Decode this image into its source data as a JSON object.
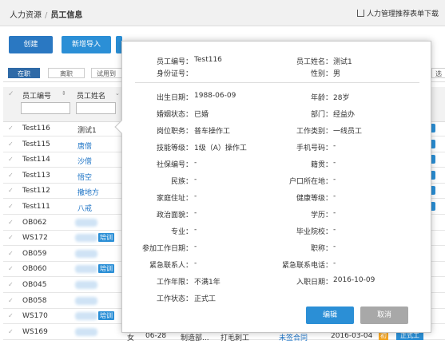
{
  "breadcrumb": {
    "root": "人力资源",
    "sep": "/",
    "current": "员工信息"
  },
  "download": {
    "label": "人力管理推荐表单下载"
  },
  "toolbar": {
    "create": "创建",
    "batch_import": "新增导入"
  },
  "filters": {
    "active": "在职",
    "inactive": "离职",
    "probation": "试用到期"
  },
  "extra_filter": "选",
  "table": {
    "headers": {
      "employee_id": "员工编号",
      "employee_name": "员工姓名"
    },
    "rows": [
      {
        "id": "Test116",
        "name": "测试1",
        "name_style": "plain",
        "tag": ""
      },
      {
        "id": "Test115",
        "name": "唐僧",
        "name_style": "link",
        "tag": ""
      },
      {
        "id": "Test114",
        "name": "沙僧",
        "name_style": "link",
        "tag": ""
      },
      {
        "id": "Test113",
        "name": "悟空",
        "name_style": "link",
        "tag": ""
      },
      {
        "id": "Test112",
        "name": "撒地方",
        "name_style": "link",
        "tag": ""
      },
      {
        "id": "Test111",
        "name": "八戒",
        "name_style": "link",
        "tag": ""
      },
      {
        "id": "OB062",
        "name": "",
        "name_style": "blur",
        "tag": ""
      },
      {
        "id": "WS172",
        "name": "",
        "name_style": "blur",
        "tag": "培训"
      },
      {
        "id": "OB059",
        "name": "",
        "name_style": "blur",
        "tag": ""
      },
      {
        "id": "OB060",
        "name": "",
        "name_style": "blur",
        "tag": "培训"
      },
      {
        "id": "OB045",
        "name": "",
        "name_style": "blur",
        "tag": ""
      },
      {
        "id": "OB058",
        "name": "",
        "name_style": "blur",
        "tag": ""
      },
      {
        "id": "WS170",
        "name": "",
        "name_style": "blur",
        "tag": "培训"
      },
      {
        "id": "WS169",
        "name": "",
        "name_style": "blur",
        "tag": ""
      }
    ],
    "bottom_row": {
      "gender": "女",
      "date": "06-28",
      "dept": "制造部...",
      "role": "打毛刺工",
      "link": "未签合同",
      "start": "2016-03-04",
      "badge": "初",
      "action": "正式工"
    }
  },
  "detail": {
    "fields": [
      {
        "label": "员工编号：",
        "value": "Test116"
      },
      {
        "label": "员工姓名：",
        "value": "测试1"
      },
      {
        "label": "身份证号：",
        "value": ""
      },
      {
        "label": "性别：",
        "value": "男"
      },
      {
        "label": "出生日期：",
        "value": "1988-06-09"
      },
      {
        "label": "年龄：",
        "value": "28岁"
      },
      {
        "label": "婚姻状态：",
        "value": "已婚"
      },
      {
        "label": "部门：",
        "value": "经益办"
      },
      {
        "label": "岗位职务：",
        "value": "普车操作工"
      },
      {
        "label": "工作类别：",
        "value": "一线员工"
      },
      {
        "label": "技能等级：",
        "value": "1级（A）操作工"
      },
      {
        "label": "手机号码：",
        "value": "-"
      },
      {
        "label": "社保编号：",
        "value": "-"
      },
      {
        "label": "籍贯：",
        "value": "-"
      },
      {
        "label": "民族：",
        "value": "-"
      },
      {
        "label": "户口所在地：",
        "value": "-"
      },
      {
        "label": "家庭住址：",
        "value": "-"
      },
      {
        "label": "健康等级：",
        "value": "-"
      },
      {
        "label": "政治面貌：",
        "value": "-"
      },
      {
        "label": "学历：",
        "value": "-"
      },
      {
        "label": "专业：",
        "value": "-"
      },
      {
        "label": "毕业院校：",
        "value": "-"
      },
      {
        "label": "参加工作日期：",
        "value": "-"
      },
      {
        "label": "职称：",
        "value": "-"
      },
      {
        "label": "紧急联系人：",
        "value": "-"
      },
      {
        "label": "紧急联系电话：",
        "value": "-"
      },
      {
        "label": "工作年限：",
        "value": "不满1年"
      },
      {
        "label": "入职日期：",
        "value": "2016-10-09"
      },
      {
        "label": "工作状态：",
        "value": "正式工"
      }
    ],
    "confirm": "编辑",
    "cancel": "取消"
  },
  "colors": {
    "primary": "#2b8fd6",
    "active_filter": "#2f6aa7",
    "cancel": "#a8a8a8",
    "link": "#1e74c6"
  }
}
